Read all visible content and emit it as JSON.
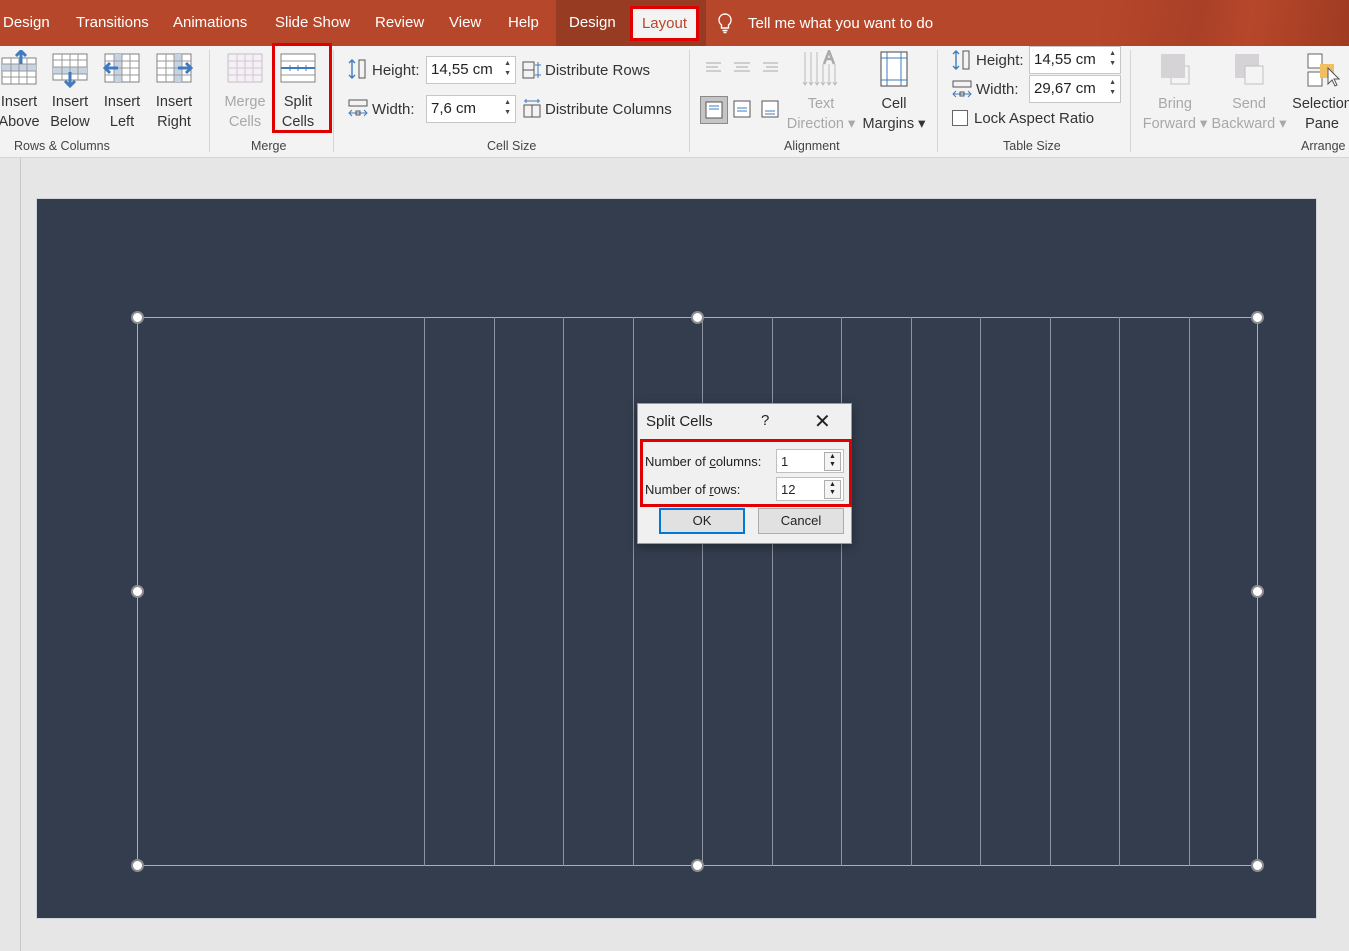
{
  "tabs": {
    "items": [
      "Design",
      "Transitions",
      "Animations",
      "Slide Show",
      "Review",
      "View",
      "Help"
    ],
    "contextual": [
      "Design",
      "Layout"
    ],
    "active": "Layout",
    "tell_me": "Tell me what you want to do"
  },
  "ribbon": {
    "rows_columns": {
      "label": "Rows & Columns",
      "insert_above": [
        "Insert",
        "Above"
      ],
      "insert_below": [
        "Insert",
        "Below"
      ],
      "insert_left": [
        "Insert",
        "Left"
      ],
      "insert_right": [
        "Insert",
        "Right"
      ]
    },
    "merge": {
      "label": "Merge",
      "merge_cells": [
        "Merge",
        "Cells"
      ],
      "split_cells": [
        "Split",
        "Cells"
      ]
    },
    "cell_size": {
      "label": "Cell Size",
      "height_label": "Height:",
      "height_value": "14,55 cm",
      "width_label": "Width:",
      "width_value": "7,6 cm",
      "distribute_rows": "Distribute Rows",
      "distribute_columns": "Distribute Columns"
    },
    "alignment": {
      "label": "Alignment",
      "text_direction": [
        "Text",
        "Direction"
      ],
      "cell_margins": [
        "Cell",
        "Margins"
      ]
    },
    "table_size": {
      "label": "Table Size",
      "height_label": "Height:",
      "height_value": "14,55 cm",
      "width_label": "Width:",
      "width_value": "29,67 cm",
      "lock_aspect": "Lock Aspect Ratio",
      "lock_aspect_checked": false
    },
    "arrange": {
      "label": "Arrange",
      "bring_forward": [
        "Bring",
        "Forward"
      ],
      "send_backward": [
        "Send",
        "Backward"
      ],
      "selection_pane": [
        "Selection",
        "Pane"
      ]
    }
  },
  "slide": {
    "table": {
      "columns": 13,
      "rows": 1
    }
  },
  "dialog": {
    "title": "Split Cells",
    "help": "?",
    "columns_label_pre": "Number of ",
    "columns_label_key": "c",
    "columns_label_post": "olumns:",
    "columns_value": "1",
    "rows_label_pre": "Number of ",
    "rows_label_key": "r",
    "rows_label_post": "ows:",
    "rows_value": "12",
    "ok": "OK",
    "cancel": "Cancel"
  },
  "colors": {
    "accent": "#b7472a",
    "highlight": "#e00000",
    "slide_bg": "#333d4e"
  }
}
